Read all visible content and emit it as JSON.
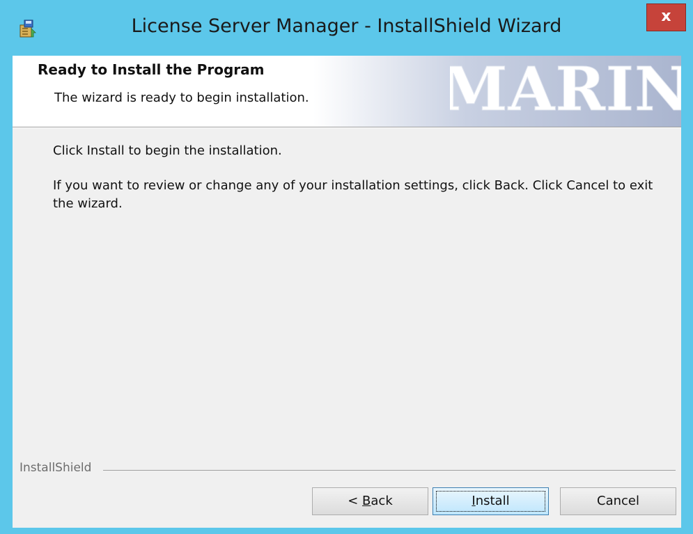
{
  "window": {
    "title": "License Server Manager - InstallShield Wizard",
    "close_label": "x"
  },
  "banner": {
    "heading": "Ready to Install the Program",
    "subheading": "The wizard is ready to begin installation.",
    "logo_text": "MARIN"
  },
  "body": {
    "line1": "Click Install to begin the installation.",
    "line2": "If you want to review or change any of your installation settings, click Back. Click Cancel to exit the wizard."
  },
  "footer": {
    "brand": "InstallShield",
    "back_prefix": "< ",
    "back_mnemonic": "B",
    "back_rest": "ack",
    "install_mnemonic": "I",
    "install_rest": "nstall",
    "cancel_label": "Cancel"
  },
  "colors": {
    "titlebar": "#5cc7ea",
    "close": "#c6433a",
    "logo": "#ffffff"
  }
}
